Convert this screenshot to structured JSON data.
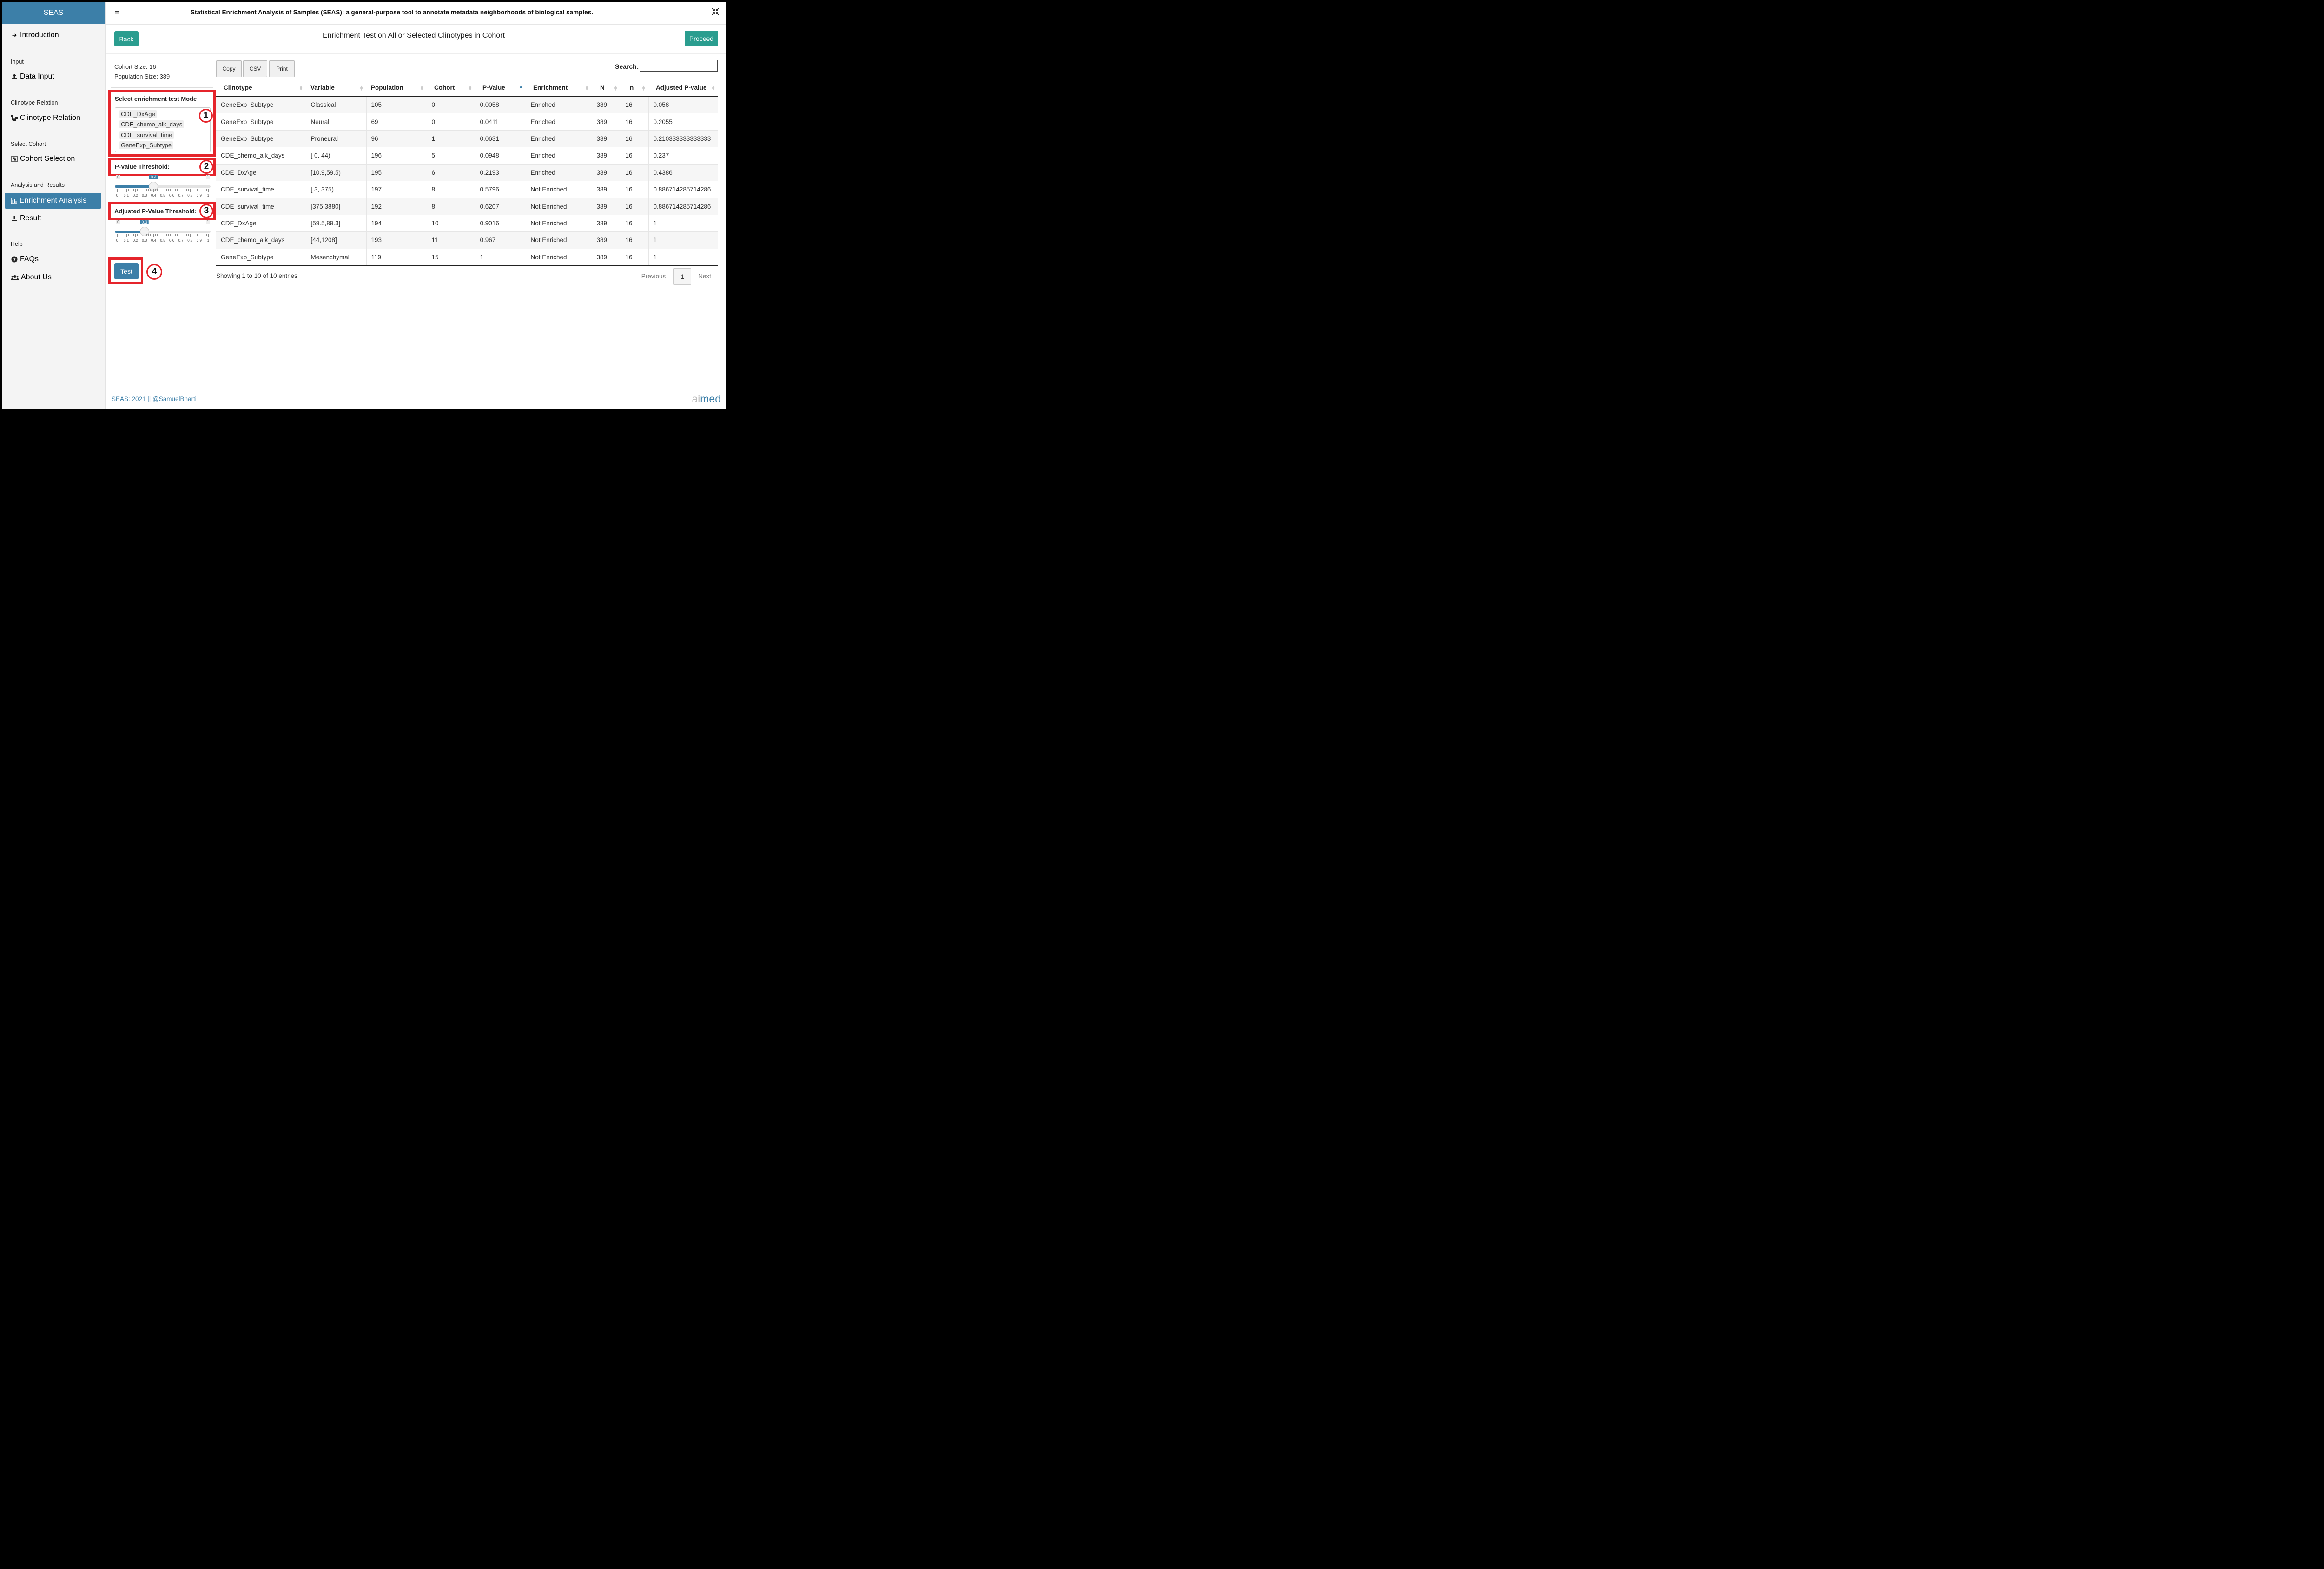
{
  "app": {
    "brand": "SEAS",
    "title": "Statistical Enrichment Analysis of Samples (SEAS): a general-purpose tool to annotate metadata neighborhoods of biological samples."
  },
  "sidebar": {
    "introduction": "Introduction",
    "input_header": "Input",
    "data_input": "Data Input",
    "clinotype_header": "Clinotype Relation",
    "clinotype_relation": "Clinotype Relation",
    "cohort_header": "Select Cohort",
    "cohort_selection": "Cohort Selection",
    "analysis_header": "Analysis and Results",
    "enrichment_analysis": "Enrichment Analysis",
    "result": "Result",
    "help_header": "Help",
    "faqs": "FAQs",
    "about_us": "About Us"
  },
  "page": {
    "back": "Back",
    "heading": "Enrichment Test on All or Selected Clinotypes in Cohort",
    "proceed": "Proceed",
    "cohort_size": "Cohort Size: 16",
    "population_size": "Population Size: 389"
  },
  "controls": {
    "mode_label": "Select enrichment test Mode",
    "mode_options": [
      "CDE_DxAge",
      "CDE_chemo_alk_days",
      "CDE_survival_time",
      "GeneExp_Subtype"
    ],
    "pvalue_label": "P-Value Threshold:",
    "pvalue_value": 0.4,
    "adj_pvalue_label": "Adjusted P-Value Threshold:",
    "adj_pvalue_value": 0.3,
    "slider_min": "0",
    "slider_max": "1",
    "slider_grid": [
      "0",
      "0.1",
      "0.2",
      "0.3",
      "0.4",
      "0.5",
      "0.6",
      "0.7",
      "0.8",
      "0.9",
      "1"
    ],
    "test": "Test",
    "badges": [
      "1",
      "2",
      "3",
      "4"
    ]
  },
  "table": {
    "buttons": [
      "Copy",
      "CSV",
      "Print"
    ],
    "search_label": "Search:",
    "search_value": "",
    "columns": [
      "Clinotype",
      "Variable",
      "Population",
      "Cohort",
      "P-Value",
      "Enrichment",
      "N",
      "n",
      "Adjusted P-value"
    ],
    "rows": [
      [
        "GeneExp_Subtype",
        "Classical",
        "105",
        "0",
        "0.0058",
        "Enriched",
        "389",
        "16",
        "0.058"
      ],
      [
        "GeneExp_Subtype",
        "Neural",
        "69",
        "0",
        "0.0411",
        "Enriched",
        "389",
        "16",
        "0.2055"
      ],
      [
        "GeneExp_Subtype",
        "Proneural",
        "96",
        "1",
        "0.0631",
        "Enriched",
        "389",
        "16",
        "0.210333333333333"
      ],
      [
        "CDE_chemo_alk_days",
        "[ 0, 44)",
        "196",
        "5",
        "0.0948",
        "Enriched",
        "389",
        "16",
        "0.237"
      ],
      [
        "CDE_DxAge",
        "[10.9,59.5)",
        "195",
        "6",
        "0.2193",
        "Enriched",
        "389",
        "16",
        "0.4386"
      ],
      [
        "CDE_survival_time",
        "[ 3, 375)",
        "197",
        "8",
        "0.5796",
        "Not Enriched",
        "389",
        "16",
        "0.886714285714286"
      ],
      [
        "CDE_survival_time",
        "[375,3880]",
        "192",
        "8",
        "0.6207",
        "Not Enriched",
        "389",
        "16",
        "0.886714285714286"
      ],
      [
        "CDE_DxAge",
        "[59.5,89.3]",
        "194",
        "10",
        "0.9016",
        "Not Enriched",
        "389",
        "16",
        "1"
      ],
      [
        "CDE_chemo_alk_days",
        "[44,1208]",
        "193",
        "11",
        "0.967",
        "Not Enriched",
        "389",
        "16",
        "1"
      ],
      [
        "GeneExp_Subtype",
        "Mesenchymal",
        "119",
        "15",
        "1",
        "Not Enriched",
        "389",
        "16",
        "1"
      ]
    ],
    "showing": "Showing 1 to 10 of 10 entries",
    "previous": "Previous",
    "page": "1",
    "next": "Next"
  },
  "footer": {
    "text": "SEAS: 2021 || @SamuelBharti",
    "logo_a": "ai",
    "logo_b": "med"
  },
  "colors": {
    "primary": "#3c7fa8",
    "teal": "#2a9d8f",
    "highlight": "#e5242b"
  }
}
